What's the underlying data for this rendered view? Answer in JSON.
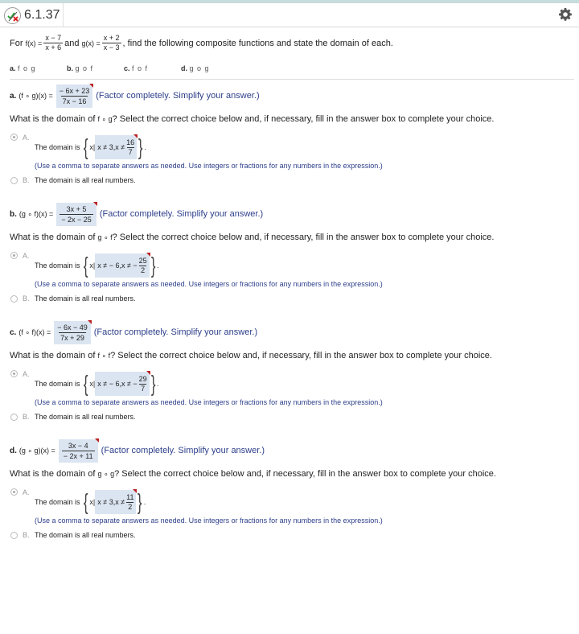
{
  "header": {
    "title": "6.1.37",
    "status_icon": "partial-correct-icon",
    "settings_icon": "gear-icon"
  },
  "problem": {
    "intro_for": "For",
    "f_label": "f(x) =",
    "f_num": "x − 7",
    "f_den": "x + 6",
    "and": "and",
    "g_label": "g(x) =",
    "g_num": "x + 2",
    "g_den": "x − 3",
    "rest": ", find the following composite functions and state the domain of each."
  },
  "parts_list": [
    {
      "letter": "a.",
      "label": "f o g"
    },
    {
      "letter": "b.",
      "label": "g o f"
    },
    {
      "letter": "c.",
      "label": "f o f"
    },
    {
      "letter": "d.",
      "label": "g o g"
    }
  ],
  "parts": [
    {
      "letter": "a.",
      "expr": "(f ∘ g)(x) =",
      "answer_num": "− 6x + 23",
      "answer_den": "7x − 16",
      "hint": "(Factor completely. Simplify your answer.)",
      "question_pre": "What is the domain of",
      "question_fn": "f ∘ g",
      "question_post": "? Select the correct choice below and, if necessary, fill in the answer box to complete your choice.",
      "choiceA_label": "A.",
      "domain_pre": "The domain is",
      "set_x": "x|",
      "set_expr": "x ≠ 3,x ≠",
      "set_frac_num": "16",
      "set_frac_den": "7",
      "set_end": ".",
      "use_hint": "(Use a comma to separate answers as needed. Use integers or fractions for any numbers in the expression.)",
      "choiceB_label": "B.",
      "choiceB_text": "The domain is all real numbers.",
      "selected": "A"
    },
    {
      "letter": "b.",
      "expr": "(g ∘ f)(x) =",
      "answer_num": "3x + 5",
      "answer_den": "− 2x − 25",
      "hint": "(Factor completely. Simplify your answer.)",
      "question_pre": "What is the domain of",
      "question_fn": "g ∘ f",
      "question_post": "? Select the correct choice below and, if necessary, fill in the answer box to complete your choice.",
      "choiceA_label": "A.",
      "domain_pre": "The domain is",
      "set_x": "x|",
      "set_expr": "x ≠ − 6,x ≠ −",
      "set_frac_num": "25",
      "set_frac_den": "2",
      "set_end": ".",
      "use_hint": "(Use a comma to separate answers as needed. Use integers or fractions for any numbers in the expression.)",
      "choiceB_label": "B.",
      "choiceB_text": "The domain is all real numbers.",
      "selected": "A"
    },
    {
      "letter": "c.",
      "expr": "(f ∘ f)(x) =",
      "answer_num": "− 6x − 49",
      "answer_den": "7x + 29",
      "hint": "(Factor completely. Simplify your answer.)",
      "question_pre": "What is the domain of",
      "question_fn": "f ∘ f",
      "question_post": "? Select the correct choice below and, if necessary, fill in the answer box to complete your choice.",
      "choiceA_label": "A.",
      "domain_pre": "The domain is",
      "set_x": "x|",
      "set_expr": "x ≠ − 6,x ≠ −",
      "set_frac_num": "29",
      "set_frac_den": "7",
      "set_end": ".",
      "use_hint": "(Use a comma to separate answers as needed. Use integers or fractions for any numbers in the expression.)",
      "choiceB_label": "B.",
      "choiceB_text": "The domain is all real numbers.",
      "selected": "A"
    },
    {
      "letter": "d.",
      "expr": "(g ∘ g)(x) =",
      "answer_num": "3x − 4",
      "answer_den": "− 2x + 11",
      "hint": "(Factor completely. Simplify your answer.)",
      "question_pre": "What is the domain of",
      "question_fn": "g ∘ g",
      "question_post": "? Select the correct choice below and, if necessary, fill in the answer box to complete your choice.",
      "choiceA_label": "A.",
      "domain_pre": "The domain is",
      "set_x": "x|",
      "set_expr": "x ≠ 3,x ≠",
      "set_frac_num": "11",
      "set_frac_den": "2",
      "set_end": ".",
      "use_hint": "(Use a comma to separate answers as needed. Use integers or fractions for any numbers in the expression.)",
      "choiceB_label": "B.",
      "choiceB_text": "The domain is all real numbers.",
      "selected": "A"
    }
  ],
  "colors": {
    "answer_box_bg": "#dbe5f1",
    "hint_text": "#2d3f8a",
    "flag_corner": "#bb2222",
    "top_strip": "#c7dcdc"
  }
}
